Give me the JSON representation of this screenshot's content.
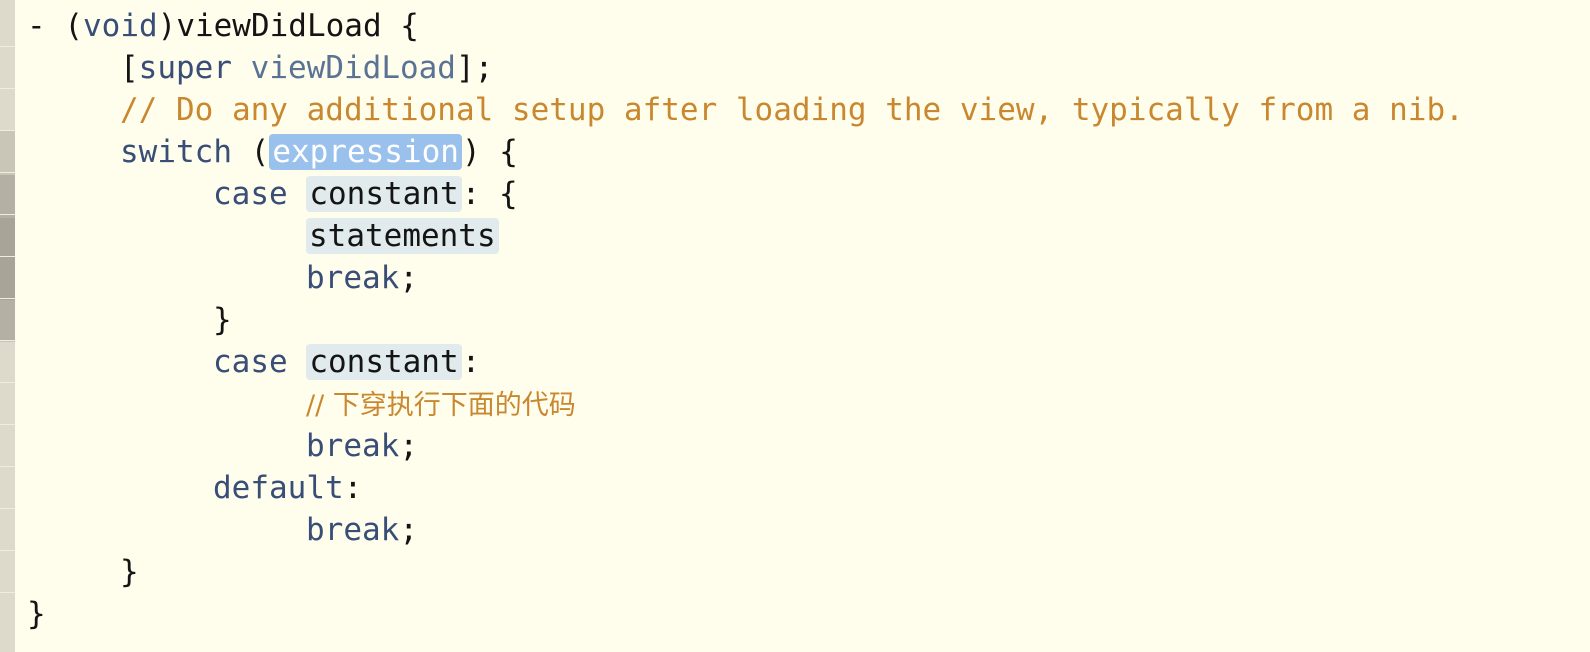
{
  "editor": {
    "theme": {
      "background": "#fffdec",
      "keyword_color": "#384e77",
      "method_color": "#5a7394",
      "comment_color": "#c9882f",
      "placeholder_bg": "#e1eaec",
      "selected_placeholder_bg": "#9ac1ec"
    },
    "lines": {
      "l1": {
        "dash": "- (",
        "void_kw": "void",
        "rest": ")viewDidLoad {"
      },
      "l2": {
        "open": "[",
        "super_kw": "super",
        "space": " ",
        "method": "viewDidLoad",
        "close": "];"
      },
      "l3": {
        "comment": "// Do any additional setup after loading the view, typically from a nib."
      },
      "l4": {
        "switch_kw": "switch",
        "open": " (",
        "placeholder": "expression",
        "close": ") {"
      },
      "l5": {
        "case_kw": "case",
        "space": " ",
        "placeholder": "constant",
        "close": ": {"
      },
      "l6": {
        "placeholder": "statements"
      },
      "l7": {
        "break_kw": "break",
        "semi": ";"
      },
      "l8": {
        "brace": "}"
      },
      "l9": {
        "case_kw": "case",
        "space": " ",
        "placeholder": "constant",
        "close": ":"
      },
      "l10": {
        "comment": "// 下穿执行下面的代码"
      },
      "l11": {
        "break_kw": "break",
        "semi": ";"
      },
      "l12": {
        "default_kw": "default",
        "colon": ":"
      },
      "l13": {
        "break_kw": "break",
        "semi": ";"
      },
      "l14": {
        "brace": "}"
      },
      "l15": {
        "brace": "}"
      }
    }
  }
}
